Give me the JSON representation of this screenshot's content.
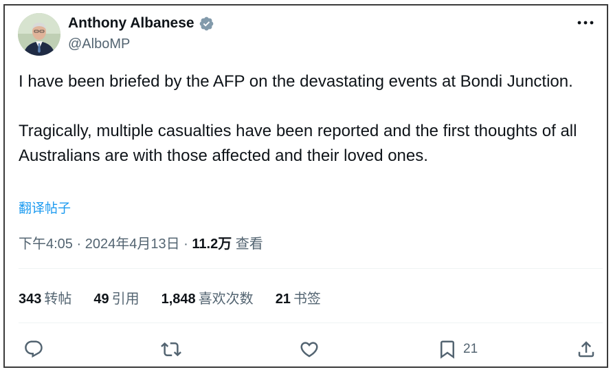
{
  "author": {
    "name": "Anthony Albanese",
    "handle": "@AlboMP"
  },
  "tweet": {
    "paragraphs": [
      "I have been briefed by the AFP on the devastating events at Bondi Junction.",
      "Tragically, multiple casualties have been reported and the first thoughts of all Australians are with those affected and their loved ones."
    ],
    "translate_label": "翻译帖子"
  },
  "meta": {
    "time": "下午4:05",
    "separator": "·",
    "date": "2024年4月13日",
    "views_count": "11.2万",
    "views_label": "查看"
  },
  "stats": {
    "reposts": {
      "count": "343",
      "label": "转帖"
    },
    "quotes": {
      "count": "49",
      "label": "引用"
    },
    "likes": {
      "count": "1,848",
      "label": "喜欢次数"
    },
    "bookmarks": {
      "count": "21",
      "label": "书签"
    }
  },
  "actions": {
    "bookmark_count": "21"
  },
  "colors": {
    "text_primary": "#0f1419",
    "text_secondary": "#536471",
    "accent": "#1d9bf0"
  },
  "icons": [
    "verified-badge-icon",
    "more-icon",
    "reply-icon",
    "repost-icon",
    "like-icon",
    "bookmark-icon",
    "share-icon"
  ]
}
